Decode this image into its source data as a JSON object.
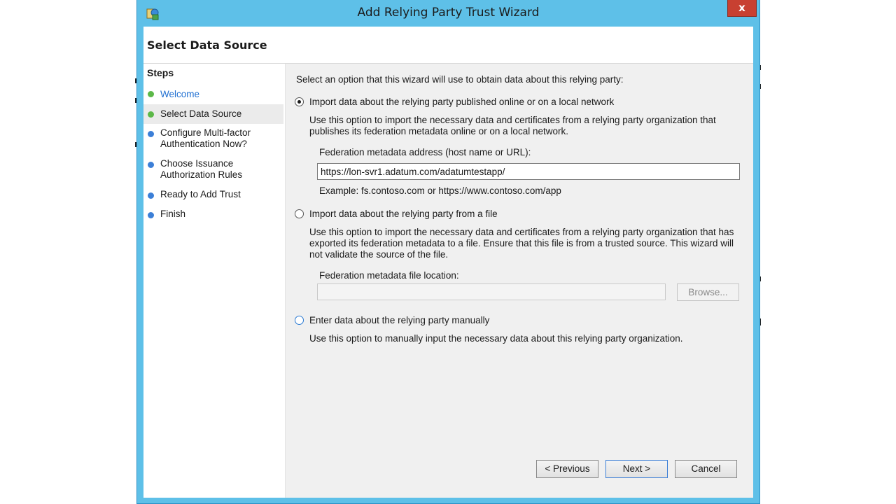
{
  "window": {
    "title": "Add Relying Party Trust Wizard",
    "close_label": "x"
  },
  "page": {
    "title": "Select Data Source"
  },
  "steps": {
    "heading": "Steps",
    "items": [
      {
        "label": "Welcome",
        "status": "done",
        "dot_color": "#5cb848"
      },
      {
        "label": "Select Data Source",
        "status": "current",
        "dot_color": "#5cb848"
      },
      {
        "label": "Configure Multi-factor\nAuthentication Now?",
        "status": "pending",
        "dot_color": "#3c7fd7"
      },
      {
        "label": "Choose Issuance\nAuthorization Rules",
        "status": "pending",
        "dot_color": "#3c7fd7"
      },
      {
        "label": "Ready to Add Trust",
        "status": "pending",
        "dot_color": "#3c7fd7"
      },
      {
        "label": "Finish",
        "status": "pending",
        "dot_color": "#3c7fd7"
      }
    ]
  },
  "main": {
    "intro": "Select an option that this wizard will use to obtain data about this relying party:",
    "options": [
      {
        "label": "Import data about the relying party published online or on a local network",
        "checked": true,
        "description": "Use this option to import the necessary data and certificates from a relying party organization that publishes its federation metadata online or on a local network.",
        "field_label": "Federation metadata address (host name or URL):",
        "field_value": "https://lon-svr1.adatum.com/adatumtestapp/",
        "example": "Example: fs.contoso.com or https://www.contoso.com/app"
      },
      {
        "label": "Import data about the relying party from a file",
        "checked": false,
        "description": "Use this option to import the necessary data and certificates from a relying party organization that has exported its federation metadata to a file. Ensure that this file is from a trusted source.  This wizard will not validate the source of the file.",
        "field_label": "Federation metadata file location:",
        "field_value": "",
        "browse_label": "Browse..."
      },
      {
        "label": "Enter data about the relying party manually",
        "checked": false,
        "description": "Use this option to manually input the necessary data about this relying party organization."
      }
    ]
  },
  "footer": {
    "previous_label": "< Previous",
    "next_label": "Next >",
    "cancel_label": "Cancel"
  },
  "colors": {
    "frame": "#5ec0e8",
    "close_button": "#c84031",
    "link": "#1f6fd1",
    "step_done": "#5cb848",
    "step_pending": "#3c7fd7"
  }
}
